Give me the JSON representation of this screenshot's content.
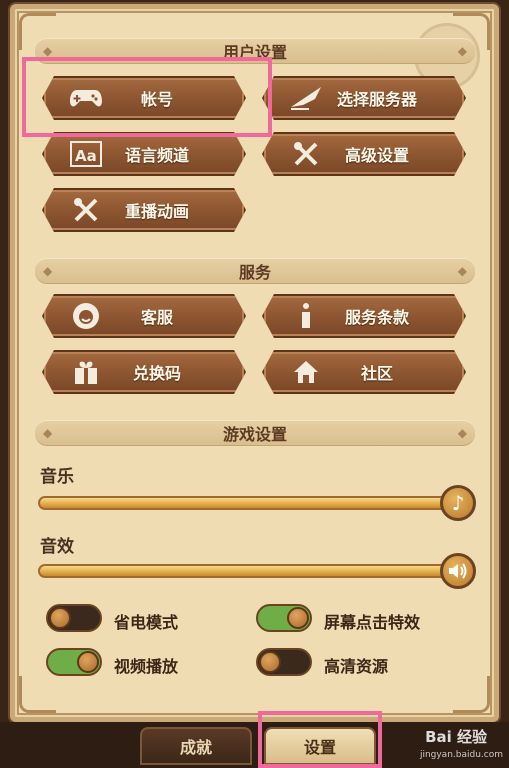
{
  "sections": {
    "user": "用户设置",
    "service": "服务",
    "game": "游戏设置"
  },
  "buttons": {
    "account": "帐号",
    "select_server": "选择服务器",
    "language_channel": "语言频道",
    "advanced": "高级设置",
    "replay_animation": "重播动画",
    "customer_service": "客服",
    "terms": "服务条款",
    "redeem_code": "兑换码",
    "community": "社区"
  },
  "audio": {
    "music_label": "音乐",
    "music_level": 1.0,
    "sfx_label": "音效",
    "sfx_level": 1.0
  },
  "toggles": [
    {
      "label": "省电模式",
      "on": false
    },
    {
      "label": "屏幕点击特效",
      "on": true
    },
    {
      "label": "视频播放",
      "on": true
    },
    {
      "label": "高清资源",
      "on": false
    }
  ],
  "tabs": {
    "achievements": "成就",
    "settings": "设置"
  },
  "watermark": {
    "text": "Bai 经验",
    "url": "jingyan.baidu.com"
  },
  "colors": {
    "highlight": "#ef6a9a",
    "toggle_on": "#6fae46",
    "button": "#8c5530"
  },
  "icons": {
    "account": "gamepad-icon",
    "select_server": "quill-icon",
    "language_channel": "aa-text-icon",
    "advanced": "tools-icon",
    "replay_animation": "tools-icon",
    "customer_service": "headset-icon",
    "terms": "info-icon",
    "redeem_code": "gift-icon",
    "community": "home-icon",
    "music": "music-note-icon",
    "sfx": "speaker-icon"
  }
}
